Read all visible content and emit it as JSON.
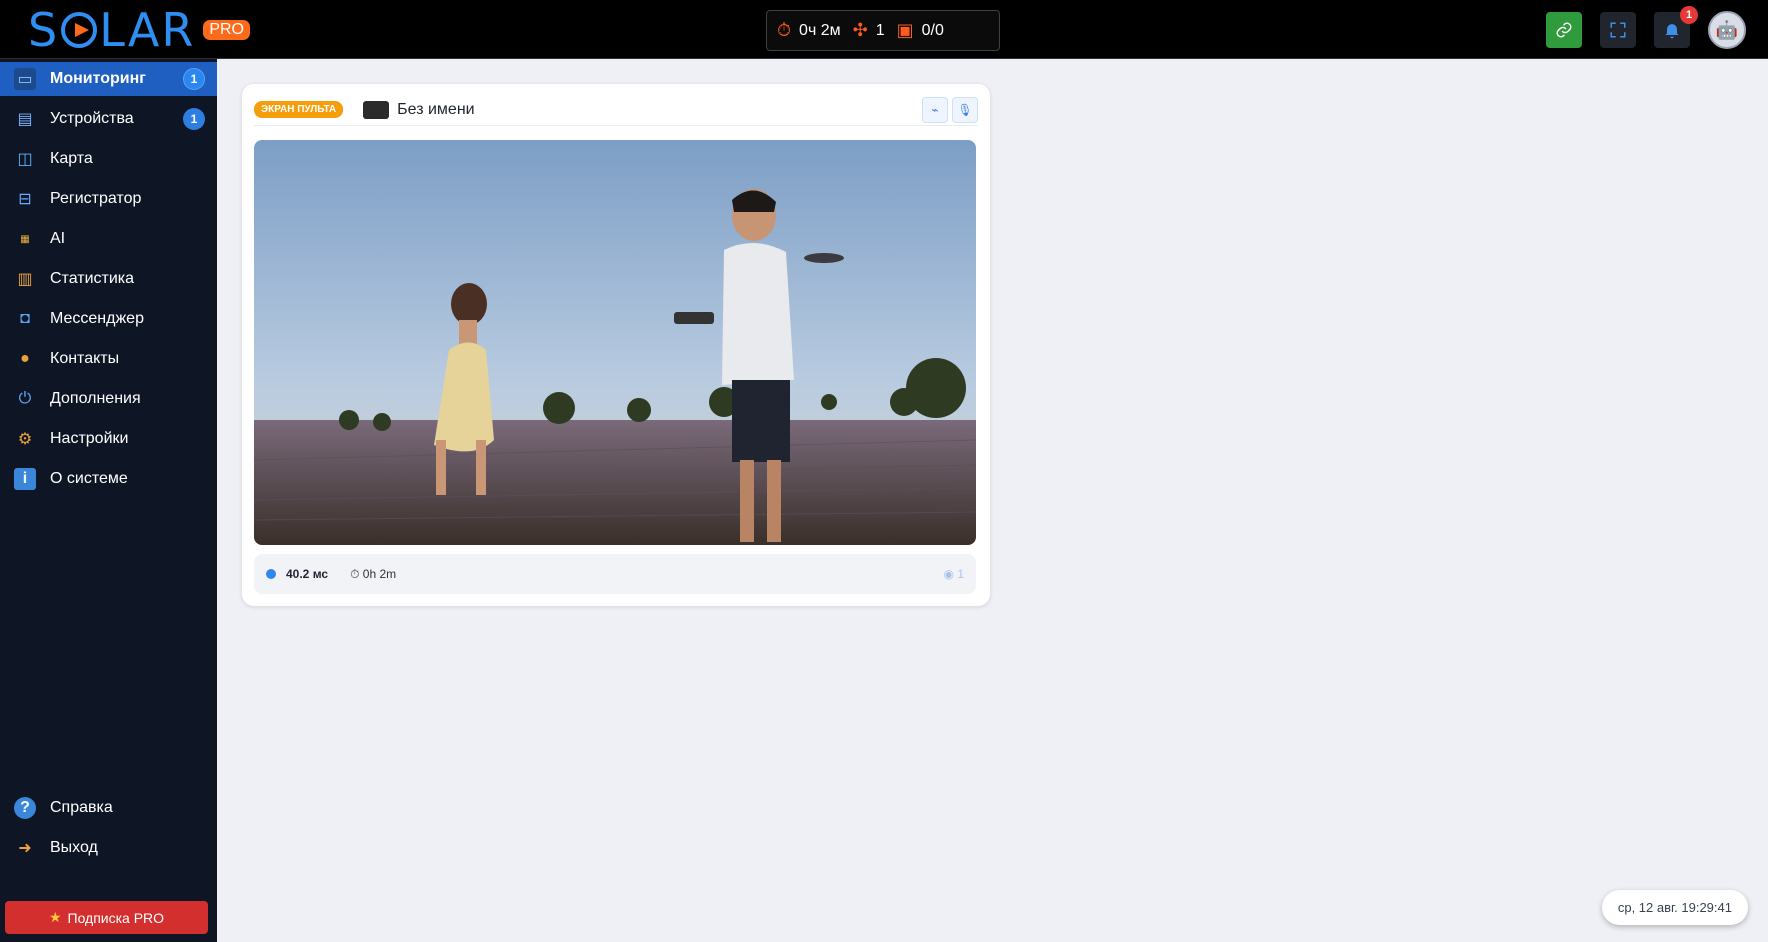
{
  "header": {
    "logo_text": "SOLAR",
    "logo_badge": "PRO",
    "stats": {
      "uptime": "0ч 2м",
      "drones": "1",
      "tasks": "0/0"
    },
    "notifications_count": "1",
    "icons": [
      "link-icon",
      "fullscreen-icon",
      "bell-icon",
      "robot-avatar"
    ]
  },
  "sidebar": {
    "items": [
      {
        "label": "Мониторинг",
        "count": "1",
        "icon": "monitor-icon"
      },
      {
        "label": "Устройства",
        "count": "1",
        "icon": "devices-icon"
      },
      {
        "label": "Карта",
        "icon": "map-icon"
      },
      {
        "label": "Регистратор",
        "icon": "recorder-icon"
      },
      {
        "label": "AI",
        "icon": "ai-icon"
      },
      {
        "label": "Статистика",
        "icon": "chart-icon"
      },
      {
        "label": "Мессенджер",
        "icon": "messenger-icon"
      },
      {
        "label": "Контакты",
        "icon": "contacts-icon"
      },
      {
        "label": "Дополнения",
        "icon": "plugins-icon"
      },
      {
        "label": "Настройки",
        "icon": "gear-icon"
      },
      {
        "label": "О системе",
        "icon": "info-icon"
      }
    ],
    "bottom_items": [
      {
        "label": "Справка",
        "icon": "help-icon"
      },
      {
        "label": "Выход",
        "icon": "logout-icon"
      }
    ],
    "pro_button": "Подписка PRO"
  },
  "card": {
    "tag": "ЭКРАН ПУЛЬТА",
    "device_name": "Без имени",
    "latency": "40.2 мс",
    "uptime": "0h 2m",
    "viewers": "1"
  },
  "footer": {
    "datetime": "ср, 12 авг. 19:29:41"
  },
  "colors": {
    "accent": "#2e8ef2",
    "brand_orange": "#ff6a1a",
    "sidebar_bg": "#0e1626",
    "active_item": "#1f5fc1",
    "pro_red": "#d32f2f"
  }
}
